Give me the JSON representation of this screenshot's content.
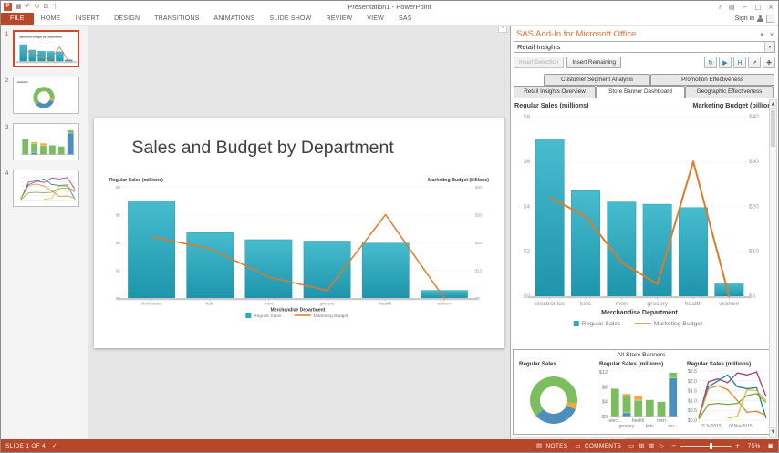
{
  "titlebar": {
    "title": "Presentation1 - PowerPoint",
    "sign_in": "Sign in"
  },
  "ribbon": {
    "tabs": [
      "FILE",
      "HOME",
      "INSERT",
      "DESIGN",
      "TRANSITIONS",
      "ANIMATIONS",
      "SLIDE SHOW",
      "REVIEW",
      "VIEW",
      "SAS"
    ]
  },
  "icons": {
    "app": "P",
    "save": "▦",
    "undo": "↶",
    "redo": "↻",
    "present": "⊡",
    "qat_more": "⋮",
    "help": "?",
    "ribbon_options": "▤",
    "minimize": "−",
    "restore": "□",
    "close": "×",
    "panel_collapse": "▾",
    "panel_close": "×",
    "dropdown_arrow": "▾",
    "pin": "^",
    "refresh": "↻",
    "pointer": "▶",
    "highlight": "H",
    "resize": "↗",
    "expand": "✚",
    "scroll_up": "▲",
    "scroll_down": "▼",
    "spell": "✓",
    "notes": "▤",
    "comments": "▭",
    "view_normal": "▭",
    "view_sorter": "⊞",
    "view_reading": "▥",
    "view_show": "▷",
    "zoom_out": "−",
    "zoom_in": "+",
    "fit": "▣"
  },
  "thumbnails": {
    "numbers": [
      "1",
      "2",
      "3",
      "4"
    ],
    "selected": "1"
  },
  "slide": {
    "title": "Sales and Budget by Department"
  },
  "sas_panel": {
    "title": "SAS Add-In for Microsoft Office",
    "selected_report": "Retail Insights",
    "insert_selection_label": "Insert Selection",
    "insert_remaining_label": "Insert Remaining",
    "tabs_row1": [
      "Customer Segment Analysis",
      "Promotion Effectiveness"
    ],
    "tabs_row2": [
      "Retail Insights Overview",
      "Store Banner Dashboard",
      "Geographic Effectiveness"
    ],
    "active_tab": "Store Banner Dashboard",
    "mini_section_title": "All Store Banners"
  },
  "status_bar": {
    "slide_indicator": "SLIDE 1 OF 4",
    "notes_label": "NOTES",
    "comments_label": "COMMENTS",
    "zoom_level": "75%"
  },
  "chart_data": [
    {
      "id": "dept_combo",
      "type": "bar",
      "combo": "bar+line",
      "title_left": "Regular Sales (millions)",
      "title_right": "Marketing Budget (billions)",
      "xlabel": "Merchandise Department",
      "categories": [
        "electronics",
        "kids",
        "men",
        "grocery",
        "health",
        "women"
      ],
      "bar_series": {
        "name": "Regular Sales",
        "color": "#2BAAC0",
        "axis": "left",
        "values": [
          7.0,
          4.7,
          4.2,
          4.1,
          3.95,
          0.55
        ]
      },
      "line_series": {
        "name": "Marketing Budget",
        "color": "#DE7A2A",
        "axis": "right",
        "values": [
          22,
          17.8,
          7.6,
          2.7,
          30,
          0
        ]
      },
      "left_axis": {
        "ticks": [
          "$0",
          "$2",
          "$4",
          "$6",
          "$8"
        ],
        "max": 8
      },
      "right_axis": {
        "ticks": [
          "$0",
          "$10",
          "$20",
          "$30",
          "$40"
        ],
        "max": 40
      },
      "legend": [
        "Regular Sales",
        "Marketing Budget"
      ]
    },
    {
      "id": "banner_donut",
      "type": "pie",
      "title": "Regular Sales",
      "start_deg": 228,
      "slices": [
        {
          "name": "green-segment",
          "value": 64,
          "color": "#7CBE5F"
        },
        {
          "name": "orange-segment",
          "value": 4,
          "color": "#F2A83B"
        },
        {
          "name": "blue-segment",
          "value": 32,
          "color": "#4D8EBB"
        }
      ]
    },
    {
      "id": "banner_stacked",
      "type": "bar",
      "stacked": true,
      "title": "Regular Sales (millions)",
      "categories": [
        "elec...",
        "grocery",
        "health",
        "kids",
        "men",
        "wo..."
      ],
      "series": [
        {
          "name": "blue",
          "color": "#4D8EBB",
          "values": [
            0,
            1.0,
            0,
            0,
            0,
            10.4
          ]
        },
        {
          "name": "green",
          "color": "#7CBE5F",
          "values": [
            7.5,
            4.5,
            4.4,
            4.5,
            4.0,
            1.4
          ]
        },
        {
          "name": "orange",
          "color": "#F2A83B",
          "values": [
            0,
            0.6,
            1.1,
            0,
            0,
            0
          ]
        }
      ],
      "y_axis": {
        "ticks": [
          "$0",
          "$4",
          "$8",
          "$12"
        ],
        "max": 12
      }
    },
    {
      "id": "banner_lines",
      "type": "line",
      "title": "Regular Sales (millions)",
      "y_axis": {
        "ticks": [
          "$0.0",
          "$0.5",
          "$1.0",
          "$1.5",
          "$2.0",
          "$2.5"
        ],
        "max": 2.5
      },
      "x_ticks": [
        "01Jul2015",
        "01Nov2015"
      ],
      "series": [
        {
          "name": "magenta",
          "color": "#A13C7C",
          "values": [
            0.1,
            1.95,
            2.1,
            1.9,
            2.4,
            2.3,
            2.45,
            1.2
          ]
        },
        {
          "name": "teal",
          "color": "#1F7FA3",
          "values": [
            0.15,
            1.7,
            2.0,
            2.3,
            1.7,
            1.6,
            1.65,
            0.1
          ]
        },
        {
          "name": "orange",
          "color": "#E5832F",
          "values": [
            0.1,
            1.6,
            1.75,
            1.55,
            1.0,
            0.4,
            0.45,
            0.25
          ]
        },
        {
          "name": "green",
          "color": "#78A83F",
          "values": [
            0.05,
            0.8,
            0.85,
            0.8,
            0.85,
            1.25,
            1.35,
            0.9
          ]
        },
        {
          "name": "gold",
          "color": "#EFB23D",
          "values": [
            null,
            null,
            null,
            0.1,
            0.2,
            1.55,
            1.5,
            1.0
          ]
        }
      ]
    }
  ]
}
